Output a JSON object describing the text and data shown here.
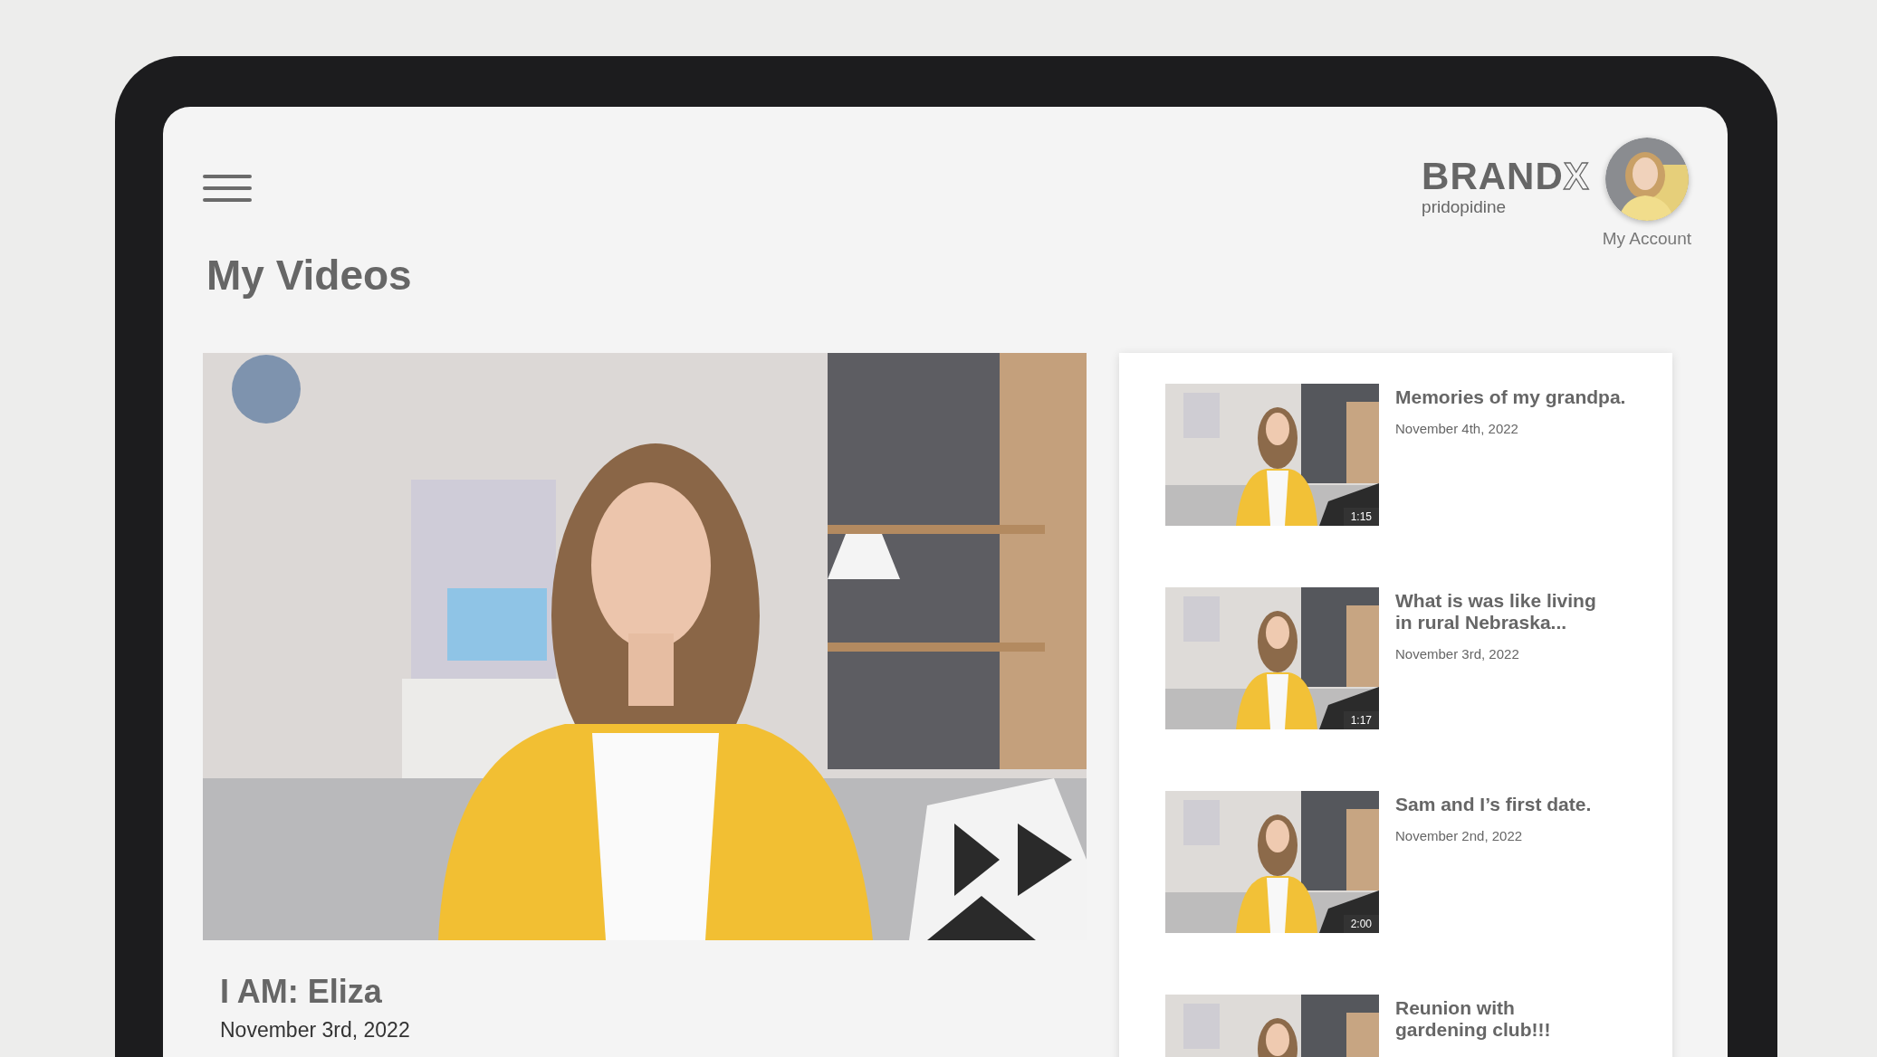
{
  "brand": {
    "name": "BRAND",
    "outline_letter": "X",
    "tagline": "pridopidine"
  },
  "account": {
    "label": "My Account"
  },
  "page_title": "My Videos",
  "featured": {
    "title": "I AM: Eliza",
    "date": "November 3rd, 2022"
  },
  "videos": [
    {
      "title": "Memories of my grandpa.",
      "date": "November 4th, 2022",
      "duration": "1:15"
    },
    {
      "title": "What is was like living\nin rural Nebraska...",
      "date": "November 3rd, 2022",
      "duration": "1:17"
    },
    {
      "title": "Sam and I’s first date.",
      "date": "November 2nd, 2022",
      "duration": "2:00"
    },
    {
      "title": "Reunion with\ngardening club!!!"
    }
  ]
}
